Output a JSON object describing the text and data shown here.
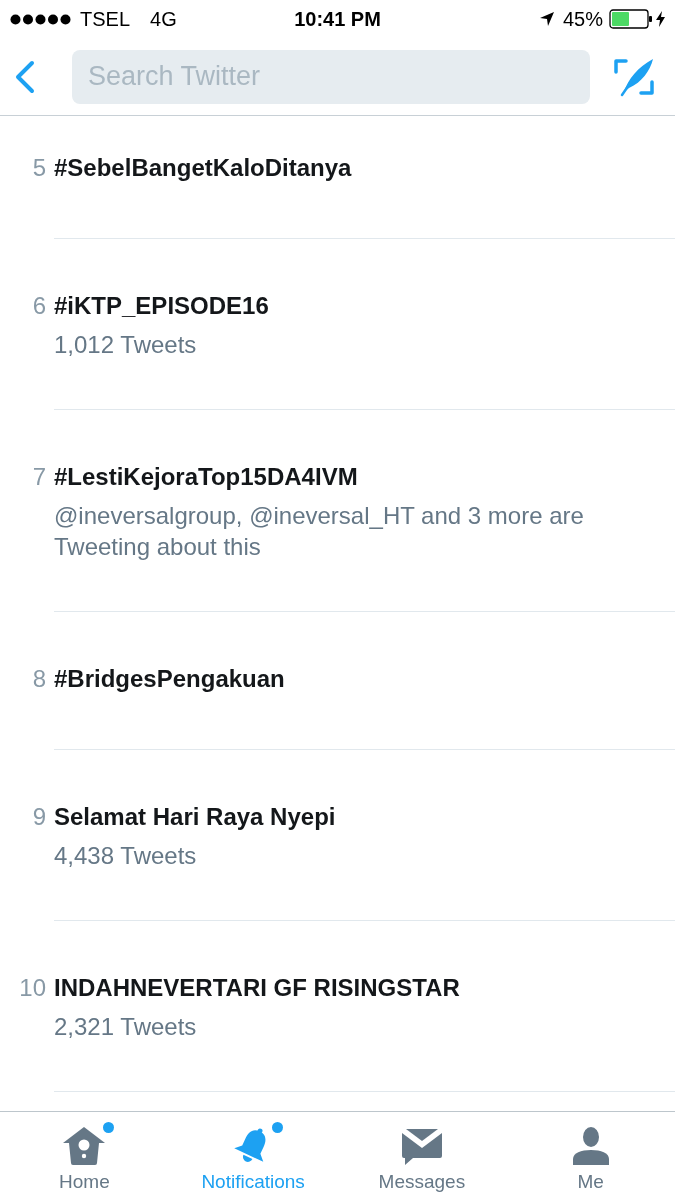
{
  "status_bar": {
    "carrier": "TSEL",
    "network": "4G",
    "time": "10:41 PM",
    "battery": "45%",
    "charging": true
  },
  "nav_bar": {
    "search": {
      "placeholder": "Search Twitter"
    }
  },
  "trends": [
    {
      "rank": "5",
      "title": "#SebelBangetKaloDitanya"
    },
    {
      "rank": "6",
      "title": "#iKTP_EPISODE16",
      "subtitle": "1,012 Tweets"
    },
    {
      "rank": "7",
      "title": "#LestiKejoraTop15DA4IVM",
      "subtitle": "@ineversalgroup, @ineversal_HT and 3 more are Tweeting about this"
    },
    {
      "rank": "8",
      "title": "#BridgesPengakuan"
    },
    {
      "rank": "9",
      "title": "Selamat Hari Raya Nyepi",
      "subtitle": "4,438 Tweets"
    },
    {
      "rank": "10",
      "title": "INDAHNEVERTARI GF RISINGSTAR",
      "subtitle": "2,321 Tweets"
    }
  ],
  "tab_bar": [
    {
      "kind": "home",
      "label": "Home",
      "selected": false,
      "dot": true
    },
    {
      "kind": "notifications",
      "label": "Notifications",
      "selected": true,
      "dot": true
    },
    {
      "kind": "messages",
      "label": "Messages",
      "selected": false,
      "dot": false
    },
    {
      "kind": "me",
      "label": "Me",
      "selected": false,
      "dot": false
    }
  ]
}
